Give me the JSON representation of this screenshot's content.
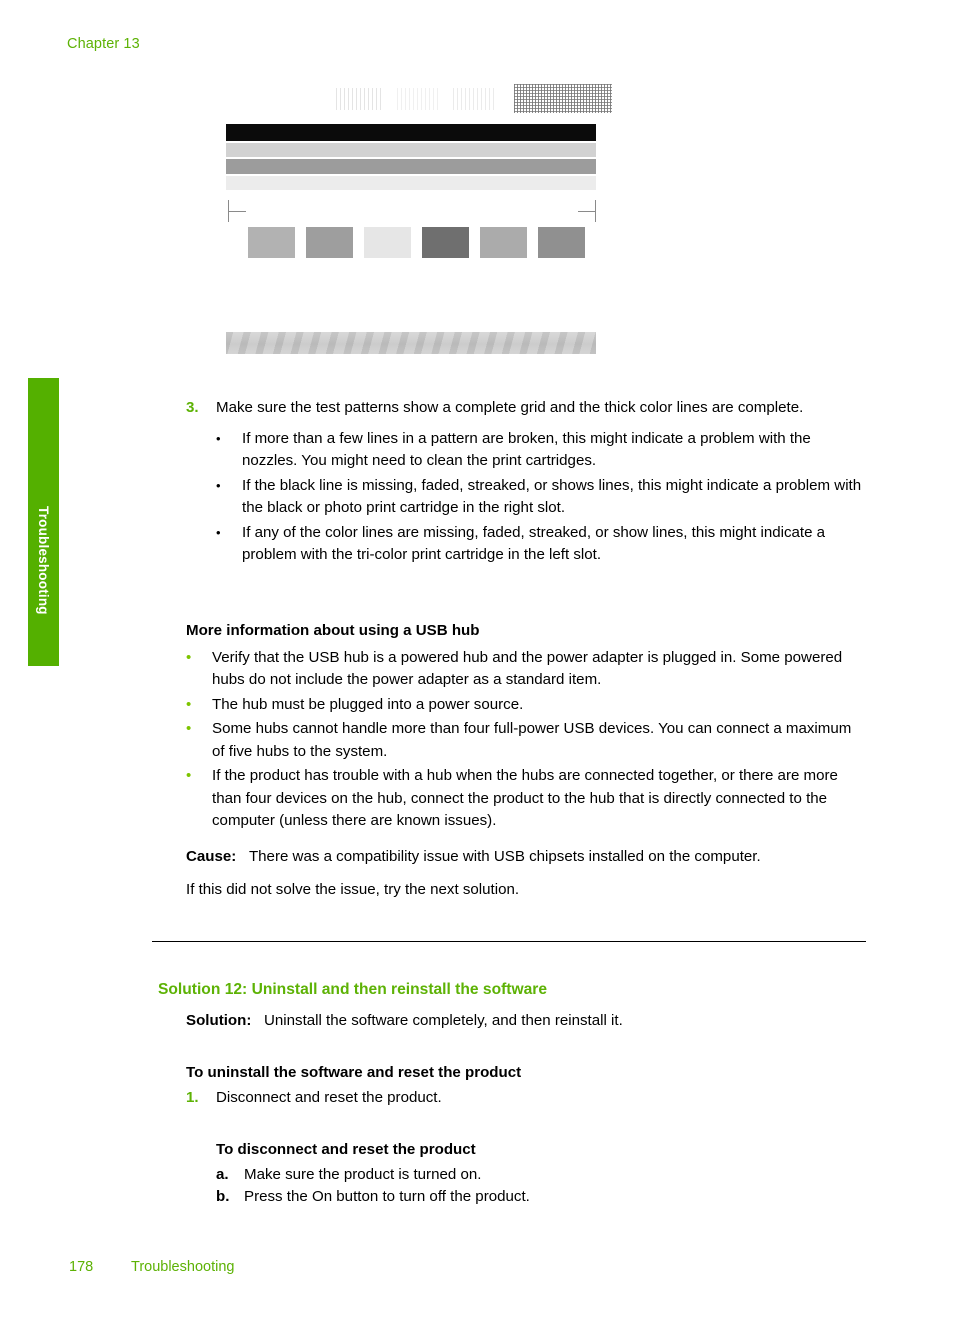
{
  "header": {
    "chapter": "Chapter 13"
  },
  "side_tab": {
    "label": "Troubleshooting",
    "color": "#54B000"
  },
  "figure": {
    "name": "printer-self-test-page",
    "nozzle_blocks": 3,
    "grid_blocks": 1,
    "bars": [
      "black",
      "light-gray",
      "medium-gray",
      "very-light-gray"
    ],
    "swatches": 6,
    "gradient_band": 1
  },
  "step3": {
    "marker": "3.",
    "text": "Make sure the test patterns show a complete grid and the thick color lines are complete.",
    "bullets": [
      "If more than a few lines in a pattern are broken, this might indicate a problem with the nozzles. You might need to clean the print cartridges.",
      "If the black line is missing, faded, streaked, or shows lines, this might indicate a problem with the black or photo print cartridge in the right slot.",
      "If any of the color lines are missing, faded, streaked, or show lines, this might indicate a problem with the tri-color print cartridge in the left slot."
    ]
  },
  "usb_hub": {
    "heading": "More information about using a USB hub",
    "bullets": [
      "Verify that the USB hub is a powered hub and the power adapter is plugged in. Some powered hubs do not include the power adapter as a standard item.",
      "The hub must be plugged into a power source.",
      "Some hubs cannot handle more than four full-power USB devices. You can connect a maximum of five hubs to the system.",
      "If the product has trouble with a hub when the hubs are connected together, or there are more than four devices on the hub, connect the product to the hub that is directly connected to the computer (unless there are known issues)."
    ]
  },
  "cause": {
    "label": "Cause:",
    "text": "There was a compatibility issue with USB chipsets installed on the computer.",
    "followup": "If this did not solve the issue, try the next solution."
  },
  "solution12": {
    "heading": "Solution 12: Uninstall and then reinstall the software",
    "solution_label": "Solution:",
    "solution_text": "Uninstall the software completely, and then reinstall it.",
    "procedure_heading": "To uninstall the software and reset the product",
    "step1_marker": "1.",
    "step1_text": "Disconnect and reset the product.",
    "sub_heading": "To disconnect and reset the product",
    "sub_steps": [
      {
        "marker": "a.",
        "text": "Make sure the product is turned on."
      },
      {
        "marker": "b.",
        "text": "Press the On button to turn off the product."
      }
    ]
  },
  "footer": {
    "page_number": "178",
    "section": "Troubleshooting"
  }
}
